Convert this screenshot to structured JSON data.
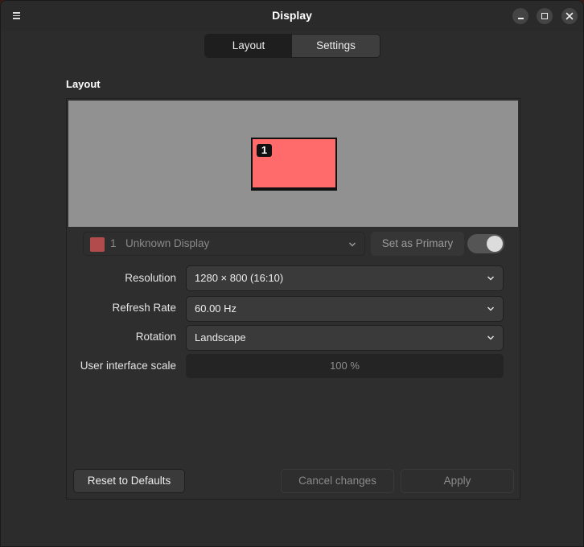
{
  "window": {
    "title": "Display",
    "menu_icon": "hamburger-icon",
    "controls": [
      "minimize-icon",
      "maximize-icon",
      "close-icon"
    ]
  },
  "tabs": [
    {
      "label": "Layout",
      "active": true
    },
    {
      "label": "Settings",
      "active": false
    }
  ],
  "section_title": "Layout",
  "arrangement": {
    "monitor_number": "1",
    "monitor_color": "#ff6a6a",
    "canvas_color": "#919191"
  },
  "display_selector": {
    "number": "1",
    "name": "Unknown Display",
    "swatch_color": "#b24b4b"
  },
  "set_primary_label": "Set as Primary",
  "primary_toggle_on": true,
  "settings": {
    "resolution": {
      "label": "Resolution",
      "value": "1280 × 800 (16:10)"
    },
    "refresh_rate": {
      "label": "Refresh Rate",
      "value": "60.00 Hz"
    },
    "rotation": {
      "label": "Rotation",
      "value": "Landscape"
    },
    "ui_scale": {
      "label": "User interface scale",
      "value": "100 %"
    }
  },
  "buttons": {
    "reset": "Reset to Defaults",
    "cancel": "Cancel changes",
    "apply": "Apply"
  }
}
